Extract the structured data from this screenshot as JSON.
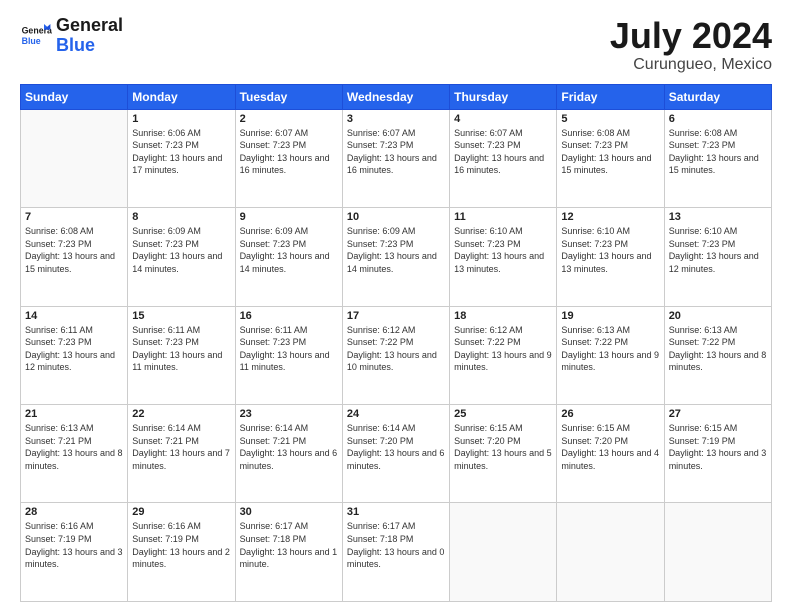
{
  "header": {
    "logo_line1": "General",
    "logo_line2": "Blue",
    "month": "July 2024",
    "location": "Curungueo, Mexico"
  },
  "weekdays": [
    "Sunday",
    "Monday",
    "Tuesday",
    "Wednesday",
    "Thursday",
    "Friday",
    "Saturday"
  ],
  "weeks": [
    [
      {
        "day": "",
        "empty": true
      },
      {
        "day": "1",
        "sunrise": "6:06 AM",
        "sunset": "7:23 PM",
        "daylight": "13 hours and 17 minutes."
      },
      {
        "day": "2",
        "sunrise": "6:07 AM",
        "sunset": "7:23 PM",
        "daylight": "13 hours and 16 minutes."
      },
      {
        "day": "3",
        "sunrise": "6:07 AM",
        "sunset": "7:23 PM",
        "daylight": "13 hours and 16 minutes."
      },
      {
        "day": "4",
        "sunrise": "6:07 AM",
        "sunset": "7:23 PM",
        "daylight": "13 hours and 16 minutes."
      },
      {
        "day": "5",
        "sunrise": "6:08 AM",
        "sunset": "7:23 PM",
        "daylight": "13 hours and 15 minutes."
      },
      {
        "day": "6",
        "sunrise": "6:08 AM",
        "sunset": "7:23 PM",
        "daylight": "13 hours and 15 minutes."
      }
    ],
    [
      {
        "day": "7",
        "sunrise": "6:08 AM",
        "sunset": "7:23 PM",
        "daylight": "13 hours and 15 minutes."
      },
      {
        "day": "8",
        "sunrise": "6:09 AM",
        "sunset": "7:23 PM",
        "daylight": "13 hours and 14 minutes."
      },
      {
        "day": "9",
        "sunrise": "6:09 AM",
        "sunset": "7:23 PM",
        "daylight": "13 hours and 14 minutes."
      },
      {
        "day": "10",
        "sunrise": "6:09 AM",
        "sunset": "7:23 PM",
        "daylight": "13 hours and 14 minutes."
      },
      {
        "day": "11",
        "sunrise": "6:10 AM",
        "sunset": "7:23 PM",
        "daylight": "13 hours and 13 minutes."
      },
      {
        "day": "12",
        "sunrise": "6:10 AM",
        "sunset": "7:23 PM",
        "daylight": "13 hours and 13 minutes."
      },
      {
        "day": "13",
        "sunrise": "6:10 AM",
        "sunset": "7:23 PM",
        "daylight": "13 hours and 12 minutes."
      }
    ],
    [
      {
        "day": "14",
        "sunrise": "6:11 AM",
        "sunset": "7:23 PM",
        "daylight": "13 hours and 12 minutes."
      },
      {
        "day": "15",
        "sunrise": "6:11 AM",
        "sunset": "7:23 PM",
        "daylight": "13 hours and 11 minutes."
      },
      {
        "day": "16",
        "sunrise": "6:11 AM",
        "sunset": "7:23 PM",
        "daylight": "13 hours and 11 minutes."
      },
      {
        "day": "17",
        "sunrise": "6:12 AM",
        "sunset": "7:22 PM",
        "daylight": "13 hours and 10 minutes."
      },
      {
        "day": "18",
        "sunrise": "6:12 AM",
        "sunset": "7:22 PM",
        "daylight": "13 hours and 9 minutes."
      },
      {
        "day": "19",
        "sunrise": "6:13 AM",
        "sunset": "7:22 PM",
        "daylight": "13 hours and 9 minutes."
      },
      {
        "day": "20",
        "sunrise": "6:13 AM",
        "sunset": "7:22 PM",
        "daylight": "13 hours and 8 minutes."
      }
    ],
    [
      {
        "day": "21",
        "sunrise": "6:13 AM",
        "sunset": "7:21 PM",
        "daylight": "13 hours and 8 minutes."
      },
      {
        "day": "22",
        "sunrise": "6:14 AM",
        "sunset": "7:21 PM",
        "daylight": "13 hours and 7 minutes."
      },
      {
        "day": "23",
        "sunrise": "6:14 AM",
        "sunset": "7:21 PM",
        "daylight": "13 hours and 6 minutes."
      },
      {
        "day": "24",
        "sunrise": "6:14 AM",
        "sunset": "7:20 PM",
        "daylight": "13 hours and 6 minutes."
      },
      {
        "day": "25",
        "sunrise": "6:15 AM",
        "sunset": "7:20 PM",
        "daylight": "13 hours and 5 minutes."
      },
      {
        "day": "26",
        "sunrise": "6:15 AM",
        "sunset": "7:20 PM",
        "daylight": "13 hours and 4 minutes."
      },
      {
        "day": "27",
        "sunrise": "6:15 AM",
        "sunset": "7:19 PM",
        "daylight": "13 hours and 3 minutes."
      }
    ],
    [
      {
        "day": "28",
        "sunrise": "6:16 AM",
        "sunset": "7:19 PM",
        "daylight": "13 hours and 3 minutes."
      },
      {
        "day": "29",
        "sunrise": "6:16 AM",
        "sunset": "7:19 PM",
        "daylight": "13 hours and 2 minutes."
      },
      {
        "day": "30",
        "sunrise": "6:17 AM",
        "sunset": "7:18 PM",
        "daylight": "13 hours and 1 minute."
      },
      {
        "day": "31",
        "sunrise": "6:17 AM",
        "sunset": "7:18 PM",
        "daylight": "13 hours and 0 minutes."
      },
      {
        "day": "",
        "empty": true
      },
      {
        "day": "",
        "empty": true
      },
      {
        "day": "",
        "empty": true
      }
    ]
  ],
  "labels": {
    "sunrise_prefix": "Sunrise: ",
    "sunset_prefix": "Sunset: ",
    "daylight_prefix": "Daylight: "
  }
}
